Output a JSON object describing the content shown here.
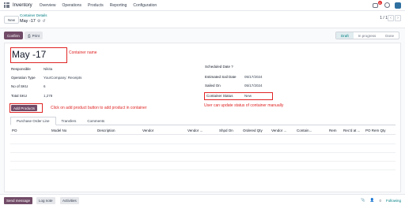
{
  "navbar": {
    "brand": "Inventory",
    "menu": [
      "Overview",
      "Operations",
      "Products",
      "Reporting",
      "Configuration"
    ],
    "chat_badge": "6"
  },
  "control": {
    "new_label": "New",
    "breadcrumb": "Container Details",
    "record_name": "May -17",
    "pager": "1 / 1"
  },
  "actions": {
    "confirm_label": "Confirm",
    "print_label": "Print",
    "stages": [
      "Draft",
      "In progress",
      "Done"
    ],
    "active_stage": "Draft"
  },
  "form": {
    "title": "May -17",
    "title_note": "Container name",
    "left_fields": [
      {
        "label": "Responsible",
        "value": "Nikita"
      },
      {
        "label": "Operation Type",
        "value": "YourCompany: Receipts"
      },
      {
        "label": "No of SKU",
        "value": "6"
      },
      {
        "label": "Total SKU",
        "value": "1,278"
      }
    ],
    "right_fields": [
      {
        "label": "Scheduled Date ?",
        "value": ""
      },
      {
        "label": "Estimated Sail Date",
        "value": "05/17/2024"
      },
      {
        "label": "Sailed On",
        "value": "05/17/2024"
      },
      {
        "label": "Container Status",
        "value": "New"
      }
    ],
    "status_note": "User can update status of container manually",
    "add_products_label": "Add Products",
    "add_note": "Click on add product button to add product in container"
  },
  "tabs": [
    "Purchase Order Line",
    "Transfers",
    "Comments"
  ],
  "table": {
    "columns": [
      "PO",
      "Model No",
      "Description",
      "Vendor",
      "Vendor ...",
      "Shpd On",
      "Ordered Qty",
      "Vendor ...",
      "Contain...",
      "Rem",
      "Rec'd at ...",
      "PO Rem Qty"
    ]
  },
  "chatter": {
    "send_label": "Send message",
    "log_label": "Log note",
    "activities_label": "Activities",
    "followers": "0",
    "following_label": "Following"
  },
  "colors": {
    "primary": "#714b67",
    "teal": "#017e84",
    "annotation": "#e02424"
  }
}
